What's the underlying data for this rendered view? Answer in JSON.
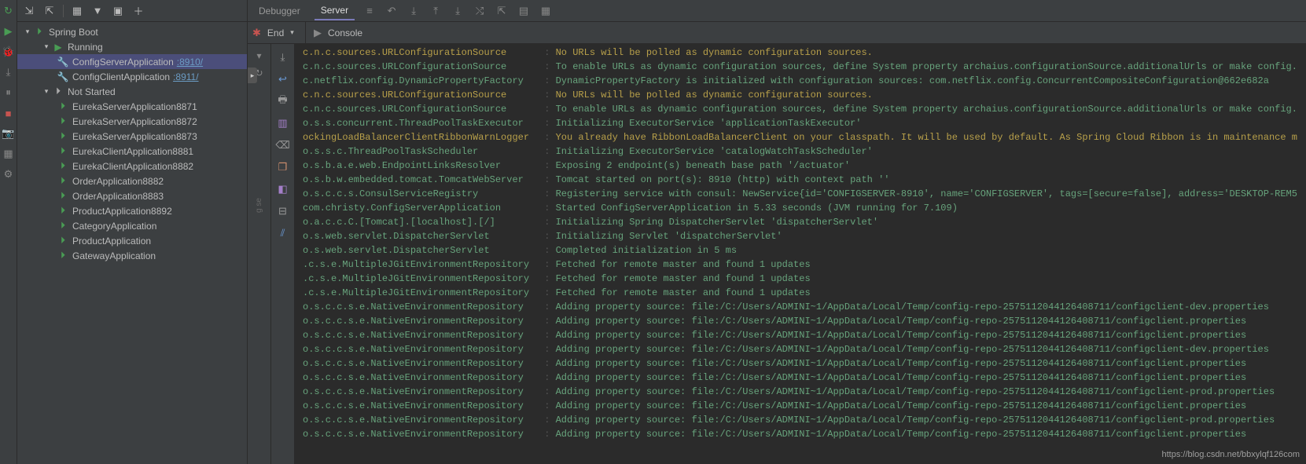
{
  "toolbar": {
    "debugger_tab": "Debugger",
    "server_tab": "Server",
    "endpoints_label": "End",
    "console_label": "Console"
  },
  "tree": {
    "root": "Spring Boot",
    "running": "Running",
    "not_started": "Not Started",
    "apps_running": [
      {
        "name": "ConfigServerApplication",
        "port": ":8910/",
        "selected": true,
        "wrench": true
      },
      {
        "name": "ConfigClientApplication",
        "port": ":8911/",
        "selected": false,
        "wrench": true
      }
    ],
    "apps_not_started": [
      "EurekaServerApplication8871",
      "EurekaServerApplication8872",
      "EurekaServerApplication8873",
      "EurekaClientApplication8881",
      "EurekaClientApplication8882",
      "OrderApplication8882",
      "OrderApplication8883",
      "ProductApplication8892",
      "CategoryApplication",
      "ProductApplication",
      "GatewayApplication"
    ]
  },
  "console_lines": [
    {
      "src": "c.n.c.sources.URLConfigurationSource",
      "srcClass": "yellow",
      "msg": "No URLs will be polled as dynamic configuration sources.",
      "msgClass": "yellow"
    },
    {
      "src": "c.n.c.sources.URLConfigurationSource",
      "msg": "To enable URLs as dynamic configuration sources, define System property archaius.configurationSource.additionalUrls or make config."
    },
    {
      "src": "c.netflix.config.DynamicPropertyFactory",
      "msg": "DynamicPropertyFactory is initialized with configuration sources: com.netflix.config.ConcurrentCompositeConfiguration@662e682a"
    },
    {
      "src": "c.n.c.sources.URLConfigurationSource",
      "srcClass": "yellow",
      "msg": "No URLs will be polled as dynamic configuration sources.",
      "msgClass": "yellow"
    },
    {
      "src": "c.n.c.sources.URLConfigurationSource",
      "msg": "To enable URLs as dynamic configuration sources, define System property archaius.configurationSource.additionalUrls or make config."
    },
    {
      "src": "o.s.s.concurrent.ThreadPoolTaskExecutor",
      "msg": "Initializing ExecutorService 'applicationTaskExecutor'"
    },
    {
      "src": "ockingLoadBalancerClientRibbonWarnLogger",
      "srcClass": "yellow",
      "msg": "You already have RibbonLoadBalancerClient on your classpath. It will be used by default. As Spring Cloud Ribbon is in maintenance m",
      "msgClass": "yellow"
    },
    {
      "src": "o.s.s.c.ThreadPoolTaskScheduler",
      "msg": "Initializing ExecutorService 'catalogWatchTaskScheduler'"
    },
    {
      "src": "o.s.b.a.e.web.EndpointLinksResolver",
      "msg": "Exposing 2 endpoint(s) beneath base path '/actuator'"
    },
    {
      "src": "o.s.b.w.embedded.tomcat.TomcatWebServer",
      "msg": "Tomcat started on port(s): 8910 (http) with context path ''"
    },
    {
      "src": "o.s.c.c.s.ConsulServiceRegistry",
      "msg": "Registering service with consul: NewService{id='CONFIGSERVER-8910', name='CONFIGSERVER', tags=[secure=false], address='DESKTOP-REM5"
    },
    {
      "src": "com.christy.ConfigServerApplication",
      "msg": "Started ConfigServerApplication in 5.33 seconds (JVM running for 7.109)"
    },
    {
      "src": "o.a.c.c.C.[Tomcat].[localhost].[/]",
      "msg": "Initializing Spring DispatcherServlet 'dispatcherServlet'"
    },
    {
      "src": "o.s.web.servlet.DispatcherServlet",
      "msg": "Initializing Servlet 'dispatcherServlet'"
    },
    {
      "src": "o.s.web.servlet.DispatcherServlet",
      "msg": "Completed initialization in 5 ms"
    },
    {
      "src": ".c.s.e.MultipleJGitEnvironmentRepository",
      "msg": "Fetched for remote master and found 1 updates"
    },
    {
      "src": ".c.s.e.MultipleJGitEnvironmentRepository",
      "msg": "Fetched for remote master and found 1 updates"
    },
    {
      "src": ".c.s.e.MultipleJGitEnvironmentRepository",
      "msg": "Fetched for remote master and found 1 updates"
    },
    {
      "src": "o.s.c.c.s.e.NativeEnvironmentRepository",
      "msg": "Adding property source: file:/C:/Users/ADMINI~1/AppData/Local/Temp/config-repo-2575112044126408711/configclient-dev.properties"
    },
    {
      "src": "o.s.c.c.s.e.NativeEnvironmentRepository",
      "msg": "Adding property source: file:/C:/Users/ADMINI~1/AppData/Local/Temp/config-repo-2575112044126408711/configclient.properties"
    },
    {
      "src": "o.s.c.c.s.e.NativeEnvironmentRepository",
      "msg": "Adding property source: file:/C:/Users/ADMINI~1/AppData/Local/Temp/config-repo-2575112044126408711/configclient.properties"
    },
    {
      "src": "o.s.c.c.s.e.NativeEnvironmentRepository",
      "msg": "Adding property source: file:/C:/Users/ADMINI~1/AppData/Local/Temp/config-repo-2575112044126408711/configclient-dev.properties"
    },
    {
      "src": "o.s.c.c.s.e.NativeEnvironmentRepository",
      "msg": "Adding property source: file:/C:/Users/ADMINI~1/AppData/Local/Temp/config-repo-2575112044126408711/configclient.properties"
    },
    {
      "src": "o.s.c.c.s.e.NativeEnvironmentRepository",
      "msg": "Adding property source: file:/C:/Users/ADMINI~1/AppData/Local/Temp/config-repo-2575112044126408711/configclient.properties"
    },
    {
      "src": "o.s.c.c.s.e.NativeEnvironmentRepository",
      "msg": "Adding property source: file:/C:/Users/ADMINI~1/AppData/Local/Temp/config-repo-2575112044126408711/configclient-prod.properties"
    },
    {
      "src": "o.s.c.c.s.e.NativeEnvironmentRepository",
      "msg": "Adding property source: file:/C:/Users/ADMINI~1/AppData/Local/Temp/config-repo-2575112044126408711/configclient.properties"
    },
    {
      "src": "o.s.c.c.s.e.NativeEnvironmentRepository",
      "msg": "Adding property source: file:/C:/Users/ADMINI~1/AppData/Local/Temp/config-repo-2575112044126408711/configclient-prod.properties"
    },
    {
      "src": "o.s.c.c.s.e.NativeEnvironmentRepository",
      "msg": "Adding property source: file:/C:/Users/ADMINI~1/AppData/Local/Temp/config-repo-2575112044126408711/configclient.properties"
    }
  ],
  "watermark": "https://blog.csdn.net/bbxylqf126com"
}
